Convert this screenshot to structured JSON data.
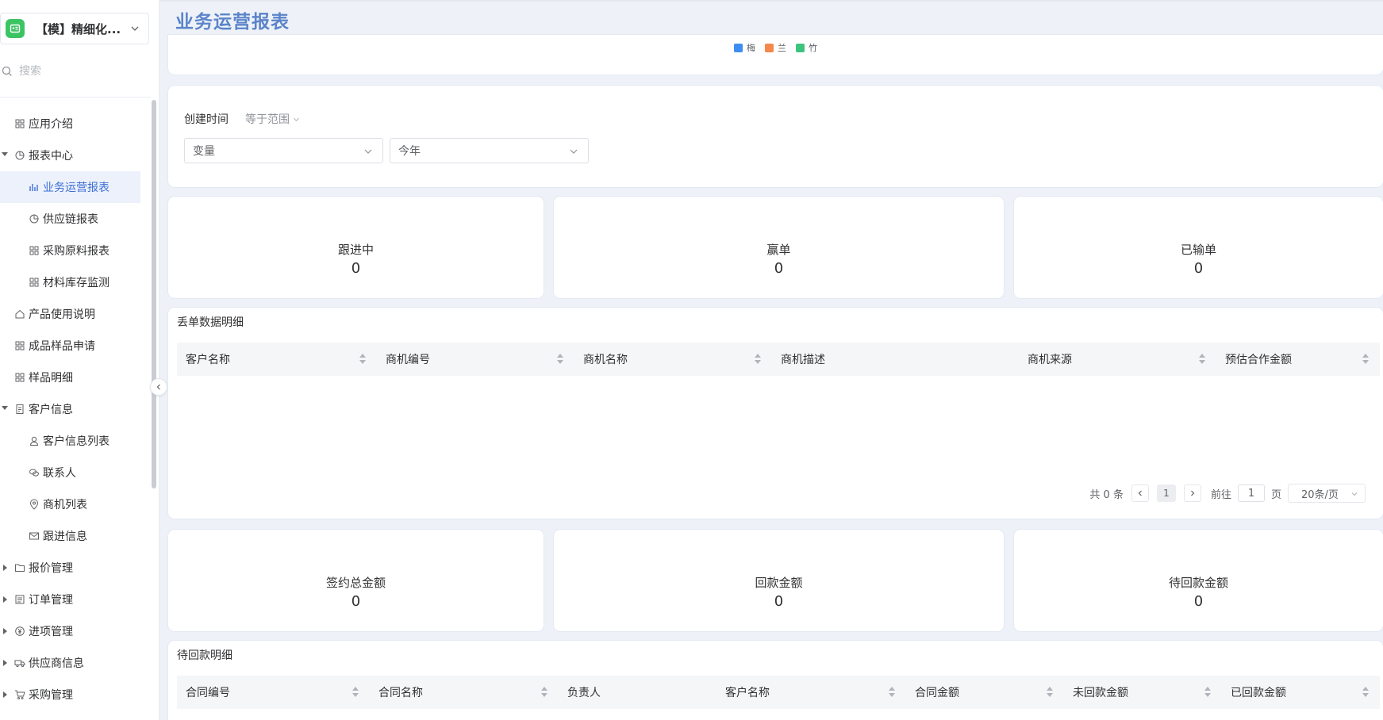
{
  "sidebar": {
    "app_name": "【模】精细化...",
    "search_placeholder": "搜索",
    "items": [
      {
        "label": "应用介绍"
      },
      {
        "label": "报表中心"
      },
      {
        "label": "业务运营报表"
      },
      {
        "label": "供应链报表"
      },
      {
        "label": "采购原料报表"
      },
      {
        "label": "材料库存监测"
      },
      {
        "label": "产品使用说明"
      },
      {
        "label": "成品样品申请"
      },
      {
        "label": "样品明细"
      },
      {
        "label": "客户信息"
      },
      {
        "label": "客户信息列表"
      },
      {
        "label": "联系人"
      },
      {
        "label": "商机列表"
      },
      {
        "label": "跟进信息"
      },
      {
        "label": "报价管理"
      },
      {
        "label": "订单管理"
      },
      {
        "label": "进项管理"
      },
      {
        "label": "供应商信息"
      },
      {
        "label": "采购管理"
      }
    ],
    "active_color": "#3e6ed6"
  },
  "page": {
    "title": "业务运营报表",
    "title_color": "#5b84c9"
  },
  "legend": {
    "items": [
      {
        "label": "梅",
        "color": "#3d8ef0"
      },
      {
        "label": "兰",
        "color": "#f5884a"
      },
      {
        "label": "竹",
        "color": "#3cc47c"
      }
    ]
  },
  "filter": {
    "label": "创建时间",
    "operator": "等于范围",
    "select1": "变量",
    "select2": "今年"
  },
  "kpis_top": [
    {
      "title": "跟进中",
      "value": "0"
    },
    {
      "title": "赢单",
      "value": "0"
    },
    {
      "title": "已输单",
      "value": "0"
    }
  ],
  "lost_table": {
    "title": "丢单数据明细",
    "columns": [
      "客户名称",
      "商机编号",
      "商机名称",
      "商机描述",
      "商机来源",
      "预估合作金额"
    ]
  },
  "pager": {
    "total": "共 0 条",
    "current": "1",
    "goto": "前往",
    "goto_value": "1",
    "page": "页",
    "size": "20条/页"
  },
  "kpis_bottom": [
    {
      "title": "签约总金额",
      "value": "0"
    },
    {
      "title": "回款金额",
      "value": "0"
    },
    {
      "title": "待回款金额",
      "value": "0"
    }
  ],
  "receivable_table": {
    "title": "待回款明细",
    "columns": [
      "合同编号",
      "合同名称",
      "负责人",
      "客户名称",
      "合同金额",
      "未回款金额",
      "已回款金额"
    ]
  }
}
